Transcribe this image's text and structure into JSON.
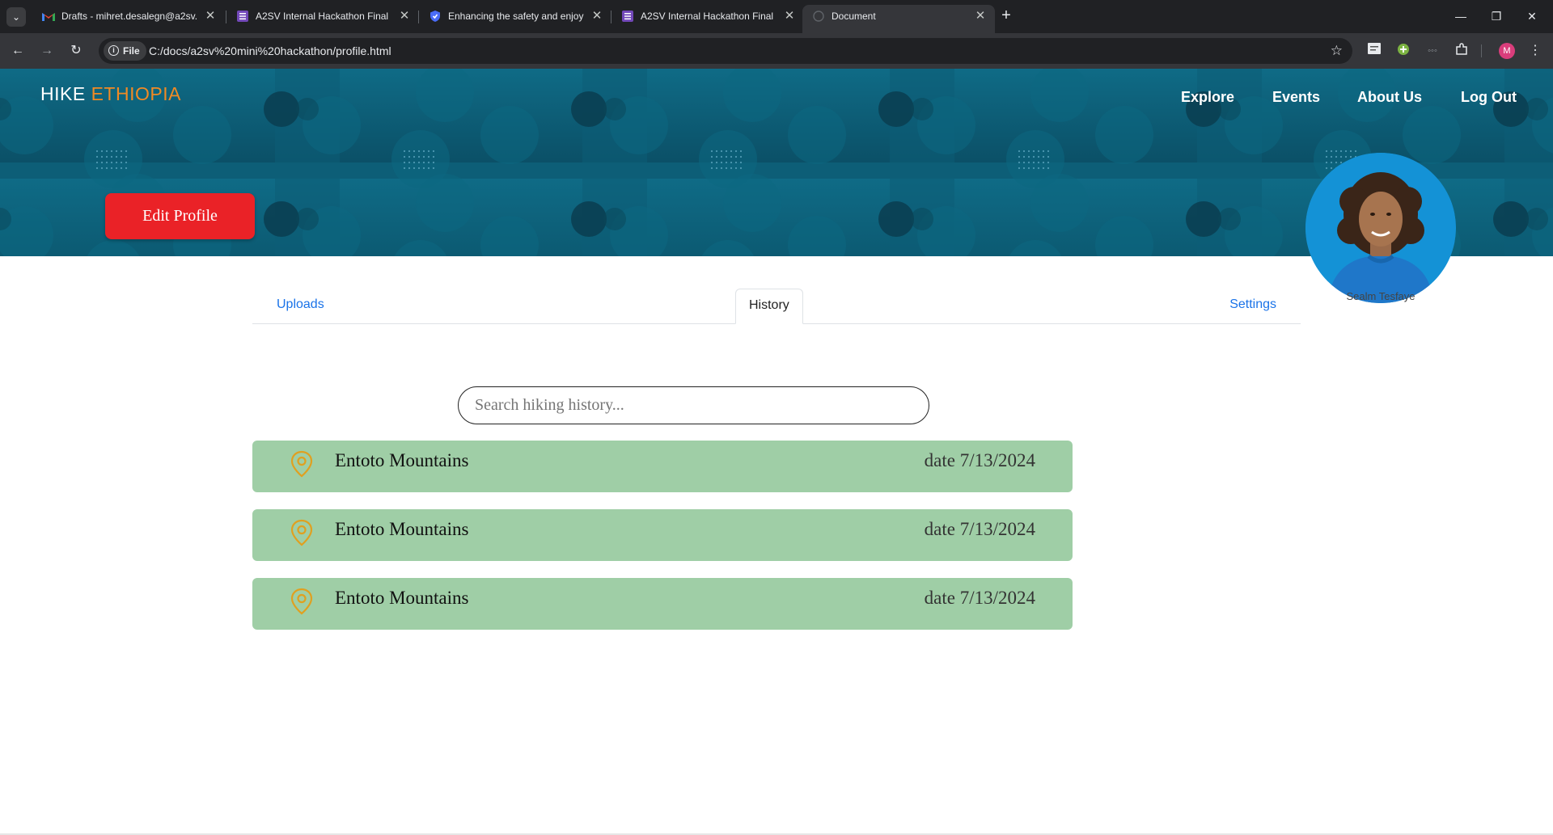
{
  "browser": {
    "tabs": [
      {
        "title": "Drafts - mihret.desalegn@a2sv...",
        "icon": "gmail-icon"
      },
      {
        "title": "A2SV Internal Hackathon Final (",
        "icon": "form-icon"
      },
      {
        "title": "Enhancing the safety and enjoy",
        "icon": "shield-icon"
      },
      {
        "title": "A2SV Internal Hackathon Final (",
        "icon": "form-icon"
      },
      {
        "title": "Document",
        "icon": "globe-icon"
      }
    ],
    "address_chip": "File",
    "url": "C:/docs/a2sv%20mini%20hackathon/profile.html",
    "profile_initial": "M"
  },
  "site": {
    "brand_part1": "HIKE ",
    "brand_part2": "ETHIOPIA",
    "nav": [
      "Explore",
      "Events",
      "About Us",
      "Log Out"
    ],
    "edit_profile": "Edit Profile",
    "user_name": "Sealm Tesfaye"
  },
  "tabs": {
    "uploads": "Uploads",
    "history": "History",
    "settings": "Settings",
    "active": "History"
  },
  "search": {
    "placeholder": "Search hiking history..."
  },
  "history": [
    {
      "place": "Entoto Mountains",
      "date": "date 7/13/2024"
    },
    {
      "place": "Entoto Mountains",
      "date": "date 7/13/2024"
    },
    {
      "place": "Entoto Mountains",
      "date": "date 7/13/2024"
    }
  ],
  "colors": {
    "hero": "#0e5a73",
    "brand_accent": "#f08a24",
    "edit_button": "#ea2227",
    "history_row": "#9fcea6",
    "pin": "#e0a020",
    "avatar_bg": "#1492d6"
  }
}
